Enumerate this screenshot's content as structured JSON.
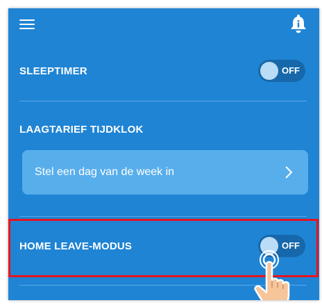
{
  "header": {
    "menu_icon": "hamburger-menu-icon",
    "bell_icon": "notification-bell-icon"
  },
  "sleeptimer": {
    "label": "SLEEPTIMER",
    "toggle_state": "OFF"
  },
  "laagtarief": {
    "label": "LAAGTARIEF TIJDKLOK",
    "button_label": "Stel een dag van de week in",
    "chevron_icon": "chevron-right-icon"
  },
  "home_leave": {
    "label": "HOME LEAVE-MODUS",
    "toggle_state": "OFF"
  },
  "colors": {
    "background": "#1f84d4",
    "button": "#58aeeb",
    "highlight": "#e6141e"
  }
}
